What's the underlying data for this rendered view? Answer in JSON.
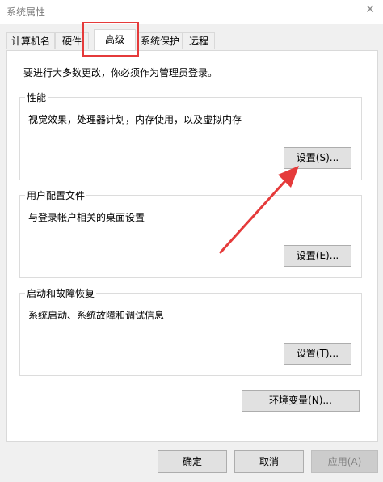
{
  "window": {
    "title": "系统属性"
  },
  "tabs": [
    {
      "label": "计算机名"
    },
    {
      "label": "硬件"
    },
    {
      "label": "高级"
    },
    {
      "label": "系统保护"
    },
    {
      "label": "远程"
    }
  ],
  "admin_note": "要进行大多数更改，你必须作为管理员登录。",
  "performance": {
    "label": "性能",
    "description": "视觉效果，处理器计划，内存使用，以及虚拟内存",
    "button": "设置(S)..."
  },
  "user_profiles": {
    "label": "用户配置文件",
    "description": "与登录帐户相关的桌面设置",
    "button": "设置(E)..."
  },
  "startup_recovery": {
    "label": "启动和故障恢复",
    "description": "系统启动、系统故障和调试信息",
    "button": "设置(T)..."
  },
  "env_button": "环境变量(N)...",
  "footer": {
    "ok": "确定",
    "cancel": "取消",
    "apply": "应用(A)"
  },
  "colors": {
    "annotation": "#e53a3a",
    "dialog_bg": "#f0f0f0",
    "button_bg": "#e1e1e1"
  }
}
